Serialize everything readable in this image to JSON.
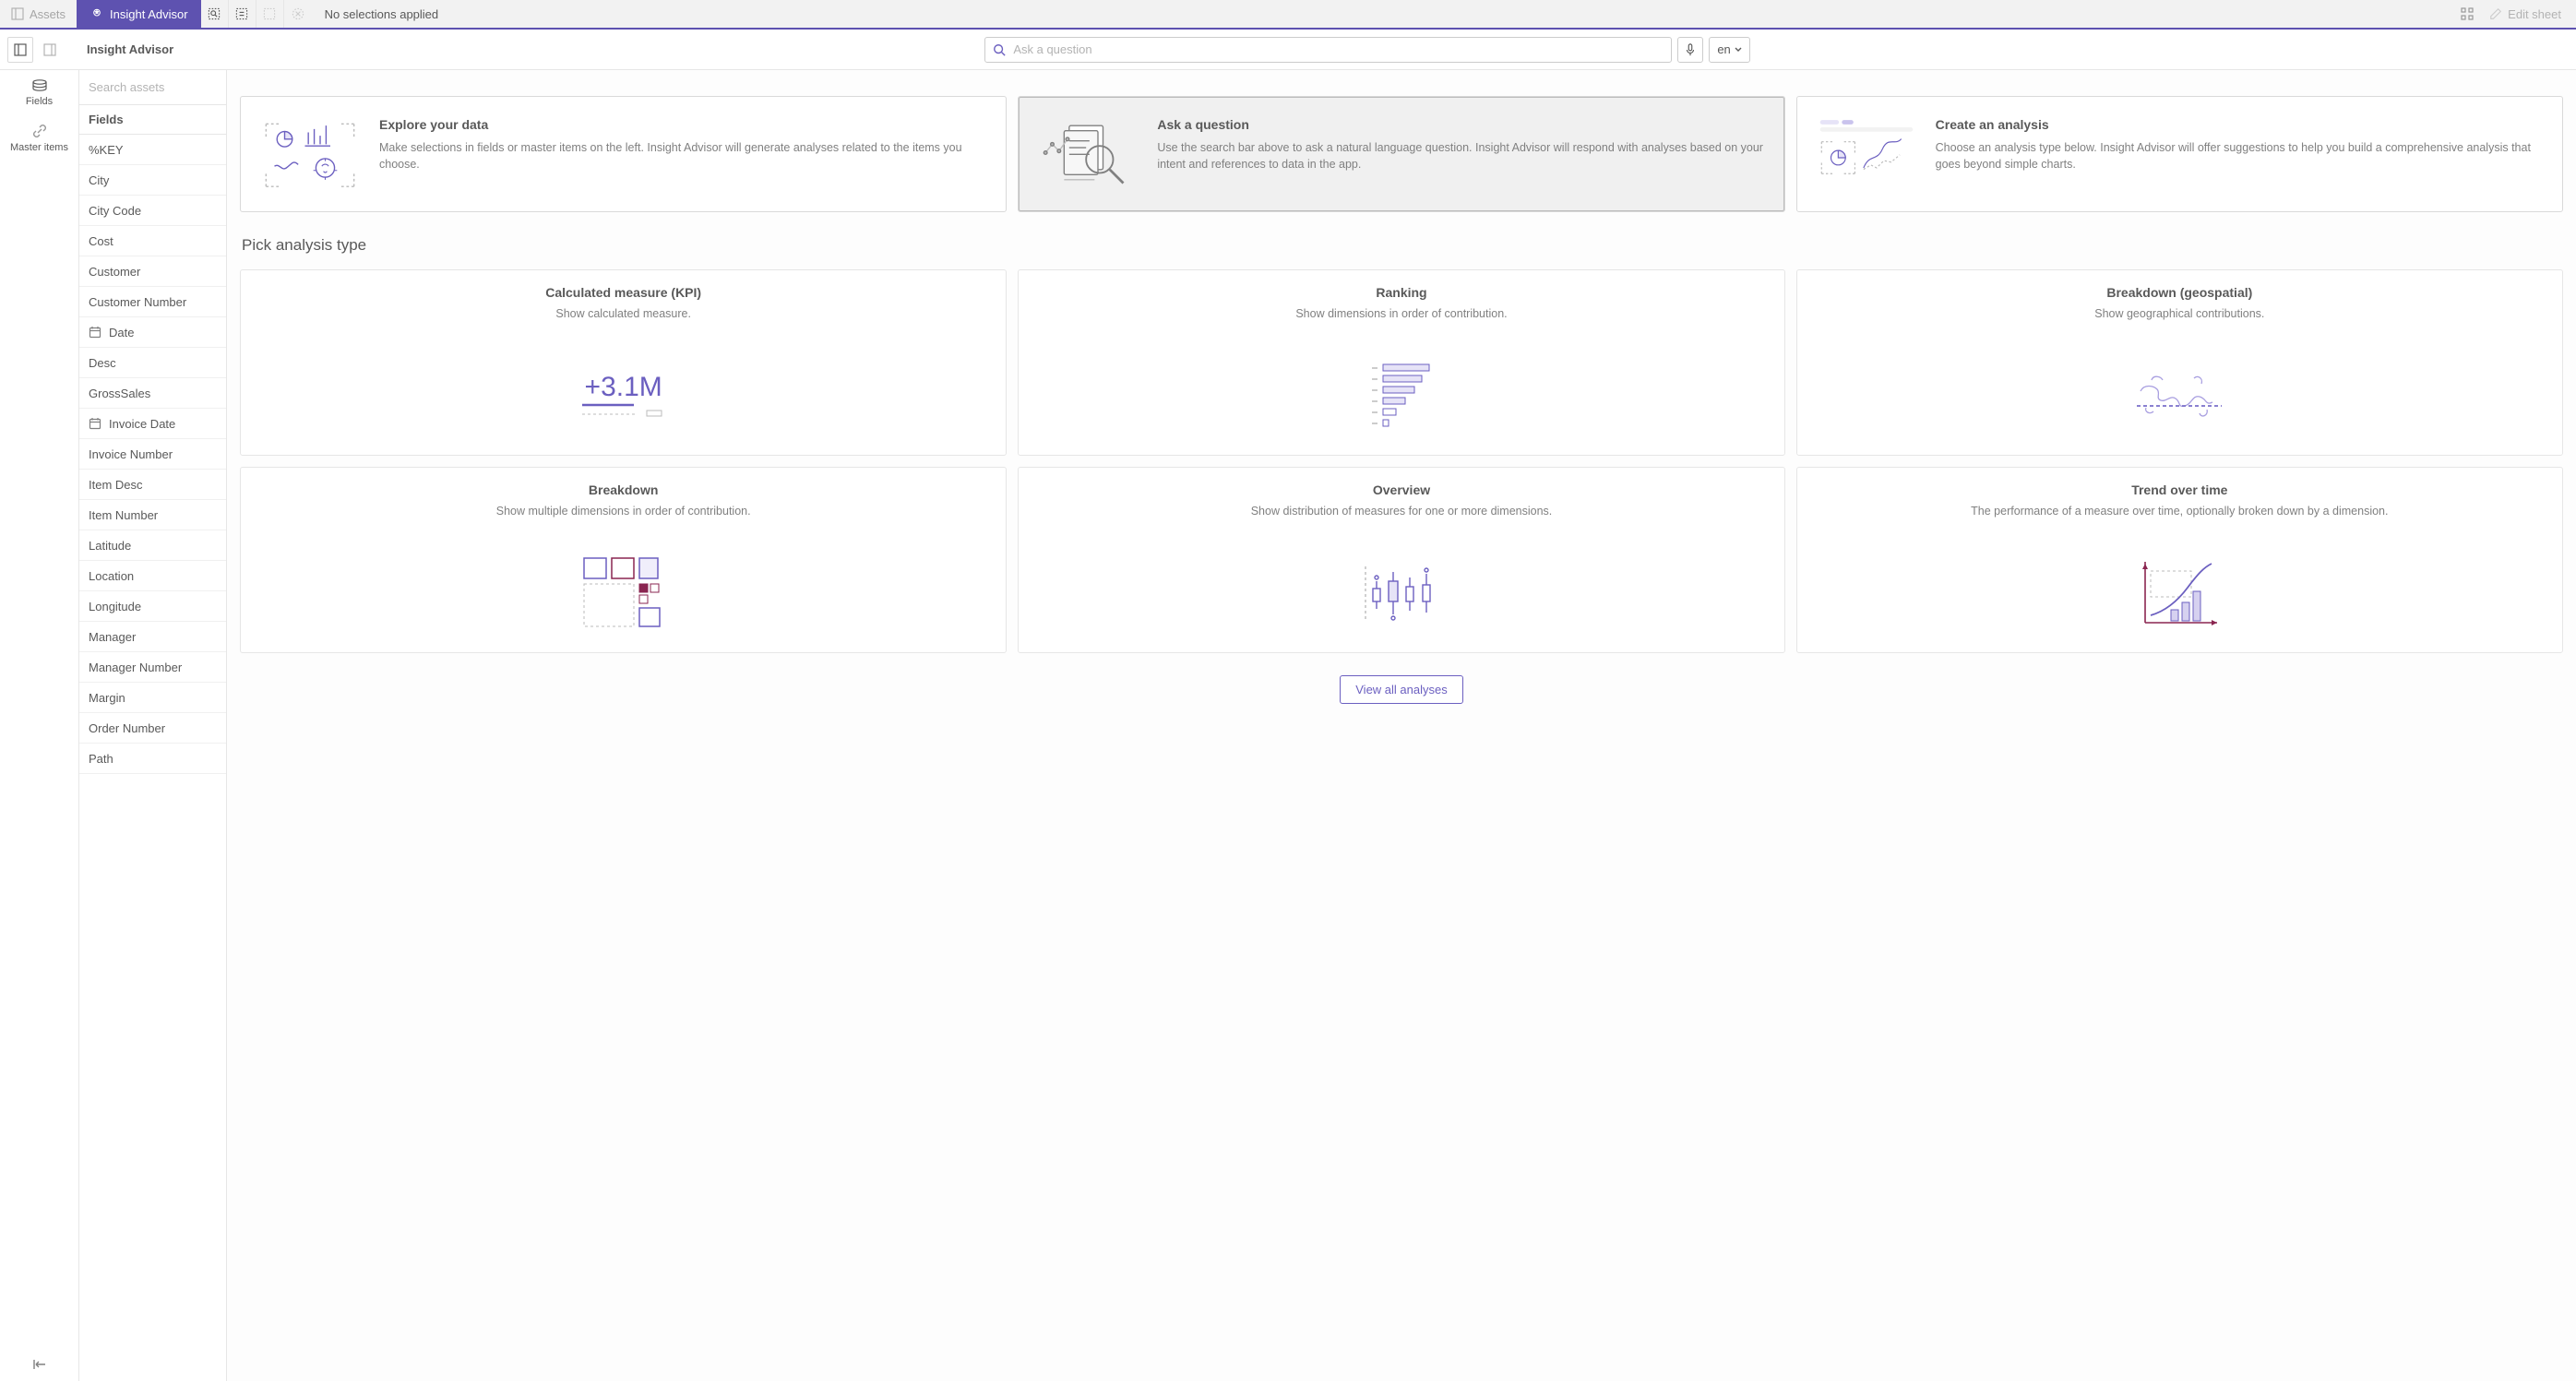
{
  "topBar": {
    "assetsLabel": "Assets",
    "advisorLabel": "Insight Advisor",
    "noSelections": "No selections applied",
    "editSheet": "Edit sheet"
  },
  "secBar": {
    "title": "Insight Advisor",
    "searchPlaceholder": "Ask a question",
    "lang": "en"
  },
  "rail": {
    "fields": "Fields",
    "masterItems": "Master items"
  },
  "fieldsPanel": {
    "searchPlaceholder": "Search assets",
    "header": "Fields",
    "items": [
      {
        "label": "%KEY",
        "icon": ""
      },
      {
        "label": "City",
        "icon": ""
      },
      {
        "label": "City Code",
        "icon": ""
      },
      {
        "label": "Cost",
        "icon": ""
      },
      {
        "label": "Customer",
        "icon": ""
      },
      {
        "label": "Customer Number",
        "icon": ""
      },
      {
        "label": "Date",
        "icon": "date"
      },
      {
        "label": "Desc",
        "icon": ""
      },
      {
        "label": "GrossSales",
        "icon": ""
      },
      {
        "label": "Invoice Date",
        "icon": "date"
      },
      {
        "label": "Invoice Number",
        "icon": ""
      },
      {
        "label": "Item Desc",
        "icon": ""
      },
      {
        "label": "Item Number",
        "icon": ""
      },
      {
        "label": "Latitude",
        "icon": ""
      },
      {
        "label": "Location",
        "icon": ""
      },
      {
        "label": "Longitude",
        "icon": ""
      },
      {
        "label": "Manager",
        "icon": ""
      },
      {
        "label": "Manager Number",
        "icon": ""
      },
      {
        "label": "Margin",
        "icon": ""
      },
      {
        "label": "Order Number",
        "icon": ""
      },
      {
        "label": "Path",
        "icon": ""
      }
    ]
  },
  "topCards": [
    {
      "title": "Explore your data",
      "desc": "Make selections in fields or master items on the left. Insight Advisor will generate analyses related to the items you choose."
    },
    {
      "title": "Ask a question",
      "desc": "Use the search bar above to ask a natural language question. Insight Advisor will respond with analyses based on your intent and references to data in the app."
    },
    {
      "title": "Create an analysis",
      "desc": "Choose an analysis type below. Insight Advisor will offer suggestions to help you build a comprehensive analysis that goes beyond simple charts."
    }
  ],
  "sectionTitle": "Pick analysis type",
  "analyses": [
    {
      "title": "Calculated measure (KPI)",
      "desc": "Show calculated measure.",
      "vis": "kpi",
      "kpiText": "+3.1M"
    },
    {
      "title": "Ranking",
      "desc": "Show dimensions in order of contribution.",
      "vis": "ranking"
    },
    {
      "title": "Breakdown (geospatial)",
      "desc": "Show geographical contributions.",
      "vis": "geo"
    },
    {
      "title": "Breakdown",
      "desc": "Show multiple dimensions in order of contribution.",
      "vis": "treemap"
    },
    {
      "title": "Overview",
      "desc": "Show distribution of measures for one or more dimensions.",
      "vis": "box"
    },
    {
      "title": "Trend over time",
      "desc": "The performance of a measure over time, optionally broken down by a dimension.",
      "vis": "trend"
    }
  ],
  "viewAll": "View all analyses"
}
